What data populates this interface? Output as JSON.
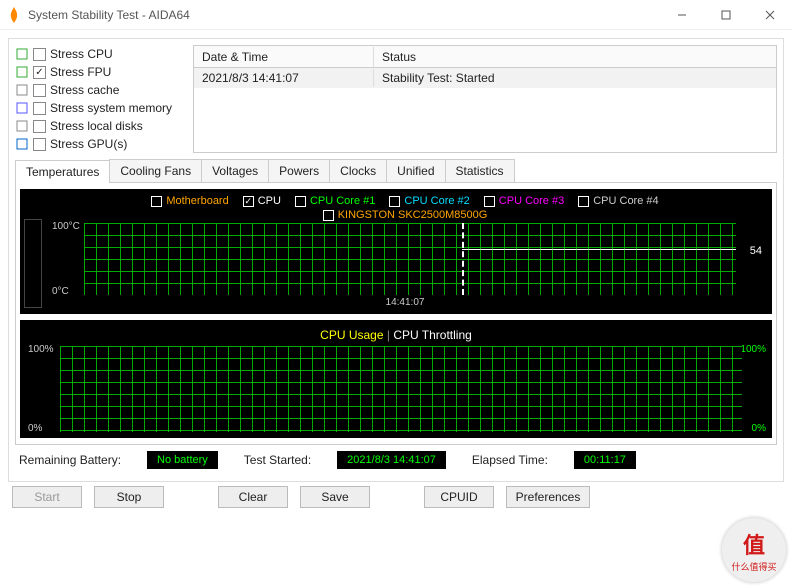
{
  "window": {
    "title": "System Stability Test - AIDA64"
  },
  "stress_options": [
    {
      "label": "Stress CPU",
      "checked": false
    },
    {
      "label": "Stress FPU",
      "checked": true
    },
    {
      "label": "Stress cache",
      "checked": false
    },
    {
      "label": "Stress system memory",
      "checked": false
    },
    {
      "label": "Stress local disks",
      "checked": false
    },
    {
      "label": "Stress GPU(s)",
      "checked": false
    }
  ],
  "log": {
    "headers": {
      "datetime": "Date & Time",
      "status": "Status"
    },
    "rows": [
      {
        "datetime": "2021/8/3 14:41:07",
        "status": "Stability Test: Started"
      }
    ]
  },
  "tabs": [
    "Temperatures",
    "Cooling Fans",
    "Voltages",
    "Powers",
    "Clocks",
    "Unified",
    "Statistics"
  ],
  "active_tab": "Temperatures",
  "temp_legend": [
    {
      "label": "Motherboard",
      "color": "#FFA500",
      "checked": false
    },
    {
      "label": "CPU",
      "color": "#FFFFFF",
      "checked": true
    },
    {
      "label": "CPU Core #1",
      "color": "#00FF00",
      "checked": false
    },
    {
      "label": "CPU Core #2",
      "color": "#00DDFF",
      "checked": false
    },
    {
      "label": "CPU Core #3",
      "color": "#FF00FF",
      "checked": false
    },
    {
      "label": "CPU Core #4",
      "color": "#CCCCCC",
      "checked": false
    }
  ],
  "temp_legend2": [
    {
      "label": "KINGSTON SKC2500M8500G",
      "color": "#FFA500",
      "checked": false
    }
  ],
  "temp_axis": {
    "ytop": "100°C",
    "ybot": "0°C",
    "xlabel": "14:41:07",
    "reading": "54"
  },
  "cpu_graph": {
    "title_usage": "CPU Usage",
    "title_sep": "|",
    "title_throttle": "CPU Throttling",
    "ltop": "100%",
    "lbot": "0%",
    "rtop": "100%",
    "rbot": "0%"
  },
  "status": {
    "battery_label": "Remaining Battery:",
    "battery_value": "No battery",
    "started_label": "Test Started:",
    "started_value": "2021/8/3 14:41:07",
    "elapsed_label": "Elapsed Time:",
    "elapsed_value": "00:11:17"
  },
  "buttons": {
    "start": "Start",
    "stop": "Stop",
    "clear": "Clear",
    "save": "Save",
    "cpuid": "CPUID",
    "prefs": "Preferences"
  },
  "watermark": {
    "char": "值",
    "text": "什么值得买"
  },
  "chart_data": [
    {
      "type": "line",
      "title": "Temperatures",
      "ylabel": "°C",
      "ylim": [
        0,
        100
      ],
      "x": [
        "14:41:07"
      ],
      "series": [
        {
          "name": "CPU",
          "values": [
            54
          ]
        }
      ]
    },
    {
      "type": "line",
      "title": "CPU Usage | CPU Throttling",
      "ylabel": "%",
      "ylim": [
        0,
        100
      ],
      "x": [],
      "series": [
        {
          "name": "CPU Usage",
          "values": []
        },
        {
          "name": "CPU Throttling",
          "values": []
        }
      ]
    }
  ]
}
